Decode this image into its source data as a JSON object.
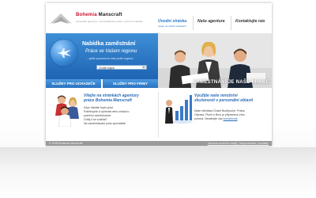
{
  "logo": {
    "name_first": "Bohemia",
    "name_rest": " Manscraft",
    "tagline": "personální agentura • zprostředkování práce • pracovní nabídky"
  },
  "nav": {
    "items": [
      {
        "label": "Úvodní stránka",
        "sub": "vítejte na našich stránkách"
      },
      {
        "label": "Naše agentura",
        "sub": ""
      },
      {
        "label": "Kontaktujte nás",
        "sub": ""
      }
    ]
  },
  "hero": {
    "title": "Nabídka zaměstnání",
    "subtitle": "Práce ve Vašem regionu",
    "small": "- výběr pracovních míst podle regionu",
    "select_value": "Zvolte region"
  },
  "tabs": [
    {
      "label": "SLUŽBY PRO UCHAZEČE"
    },
    {
      "label": "SLUŽBY PRO FIRMY"
    }
  ],
  "photo": {
    "caption": "ZAMĚSTNÁNÍ JE NAŠE PRÁCE"
  },
  "left_box": {
    "title_line1": "Vítejte na stránkách agentury",
    "title_line2": "práce Bohemia Manscraft",
    "lines": [
      "Když hledáte lepší práci",
      "Potřebujete-li vyhledat nebo získat to",
      "pravého zaměstnance",
      "Chtěj-li se vzdělat?",
      "Na zaměstnávání jsme specialisté"
    ]
  },
  "right_box": {
    "title_line1": "Využijte naše množství",
    "title_line2": "zkušeností v personální oblasti",
    "lines": [
      "Naše střediska České Budějovice, Praha,",
      "Ostrava, Plzeň a Brno je připravena Vám",
      "pomoci. Neváhejte nás"
    ],
    "link": "kontaktovat"
  },
  "footer": {
    "copyright": "© 2008 Bohemia Manscraft",
    "links": "ochrana osobních údajů | mapa stránek | kontakty"
  },
  "colors": {
    "brand_blue": "#2a78c8",
    "brand_red": "#c8102e"
  }
}
